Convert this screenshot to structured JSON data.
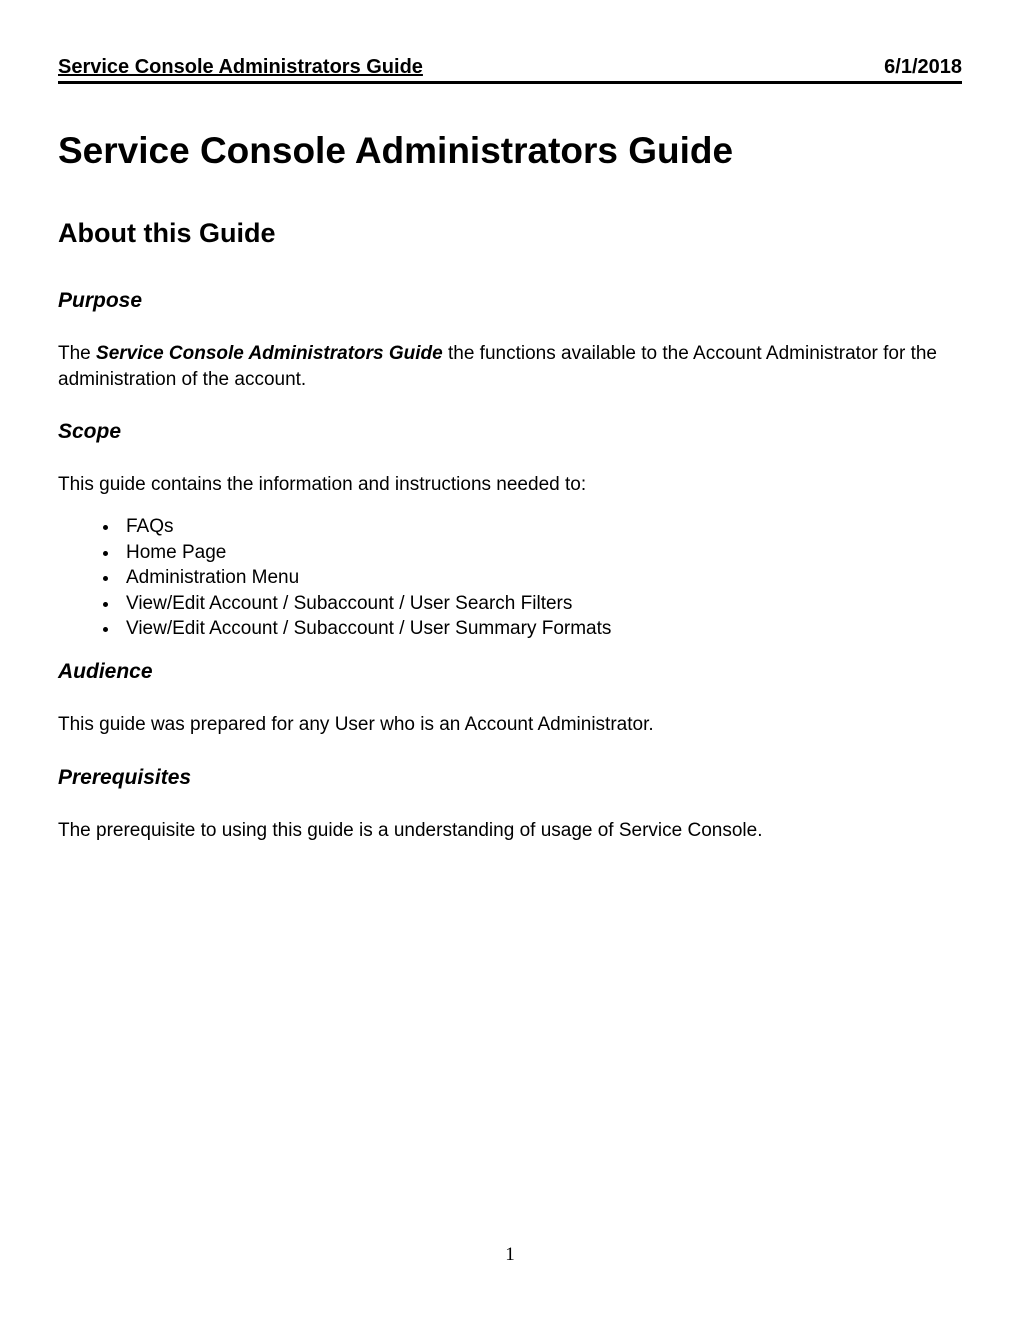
{
  "header": {
    "title": "Service Console Administrators Guide",
    "date": "6/1/2018"
  },
  "doc_title": "Service Console Administrators Guide",
  "section_heading": "About this Guide",
  "purpose": {
    "heading": "Purpose",
    "text_before": "The ",
    "bold_italic": "Service Console Administrators Guide",
    "text_after": " the functions available to the Account Administrator for the administration of the account."
  },
  "scope": {
    "heading": "Scope",
    "intro": "This guide contains the information and instructions needed to:",
    "items": [
      "FAQs",
      "Home Page",
      "Administration Menu",
      "View/Edit Account / Subaccount / User Search Filters",
      "View/Edit Account / Subaccount / User Summary Formats"
    ]
  },
  "audience": {
    "heading": "Audience",
    "text": "This guide was prepared for any User who is an Account Administrator."
  },
  "prerequisites": {
    "heading": "Prerequisites",
    "text": "The prerequisite to using this guide is a understanding of usage of Service Console."
  },
  "page_number": "1"
}
